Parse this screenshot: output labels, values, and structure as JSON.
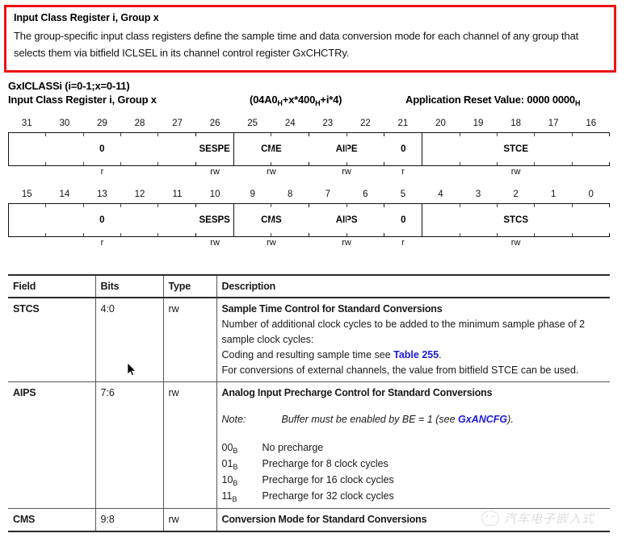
{
  "callout": {
    "title": "Input Class Register i, Group x",
    "body": "The group-specific input class registers define the sample time and data conversion mode for each channel of any group that selects them via bitfield ICLSEL in its channel control register GxCHCTRy.",
    "border_color": "#ee1111"
  },
  "register": {
    "name": "GxICLASSi (i=0-1;x=0-11)",
    "title": "Input Class Register i, Group x",
    "address_prefix": "(04A0",
    "address_mid": "+x*400",
    "address_suffix": "+i*4)",
    "reset_label": "Application Reset Value: 0000 0000",
    "hex_sub": "H"
  },
  "bit_rows": [
    {
      "numbers": [
        "31",
        "30",
        "29",
        "28",
        "27",
        "26",
        "25",
        "24",
        "23",
        "22",
        "21",
        "20",
        "19",
        "18",
        "17",
        "16"
      ],
      "fields": [
        {
          "label": "0",
          "span": 5,
          "access": "r"
        },
        {
          "label": "SESPE",
          "span": 1,
          "access": "rw"
        },
        {
          "label": "CME",
          "span": 2,
          "access": "rw"
        },
        {
          "label": "AIPE",
          "span": 2,
          "access": "rw"
        },
        {
          "label": "0",
          "span": 1,
          "access": "r"
        },
        {
          "label": "STCE",
          "span": 5,
          "access": "rw"
        }
      ]
    },
    {
      "numbers": [
        "15",
        "14",
        "13",
        "12",
        "11",
        "10",
        "9",
        "8",
        "7",
        "6",
        "5",
        "4",
        "3",
        "2",
        "1",
        "0"
      ],
      "fields": [
        {
          "label": "0",
          "span": 5,
          "access": "r"
        },
        {
          "label": "SESPS",
          "span": 1,
          "access": "rw"
        },
        {
          "label": "CMS",
          "span": 2,
          "access": "rw"
        },
        {
          "label": "AIPS",
          "span": 2,
          "access": "rw"
        },
        {
          "label": "0",
          "span": 1,
          "access": "r"
        },
        {
          "label": "STCS",
          "span": 5,
          "access": "rw"
        }
      ]
    }
  ],
  "table": {
    "headers": {
      "field": "Field",
      "bits": "Bits",
      "type": "Type",
      "description": "Description"
    },
    "rows": [
      {
        "field": "STCS",
        "bits": "4:0",
        "type": "rw",
        "desc_title": "Sample Time Control for Standard Conversions",
        "desc_line1": "Number of additional clock cycles to be added to the minimum sample phase of 2 sample clock cycles:",
        "desc_line2_pre": "Coding and resulting sample time see ",
        "desc_line2_link": "Table 255",
        "desc_line2_post": ".",
        "desc_line3": "For conversions of external channels, the value from bitfield STCE can be used."
      },
      {
        "field": "AIPS",
        "bits": "7:6",
        "type": "rw",
        "desc_title": "Analog Input Precharge Control for Standard Conversions",
        "note_label": "Note:",
        "note_pre": "Buffer must be enabled by BE = 1 (see ",
        "note_link": "GxANCFG",
        "note_post": ").",
        "codes": [
          {
            "value": "00",
            "sub": "B",
            "text": "No precharge"
          },
          {
            "value": "01",
            "sub": "B",
            "text": "Precharge for 8 clock cycles"
          },
          {
            "value": "10",
            "sub": "B",
            "text": "Precharge for 16 clock cycles"
          },
          {
            "value": "11",
            "sub": "B",
            "text": "Precharge for 32 clock cycles"
          }
        ]
      },
      {
        "field": "CMS",
        "bits": "9:8",
        "type": "rw",
        "desc_title": "Conversion Mode for Standard Conversions"
      }
    ],
    "link_color": "#1a1ae0"
  },
  "watermark": {
    "text": "汽车电子嵌入式"
  }
}
